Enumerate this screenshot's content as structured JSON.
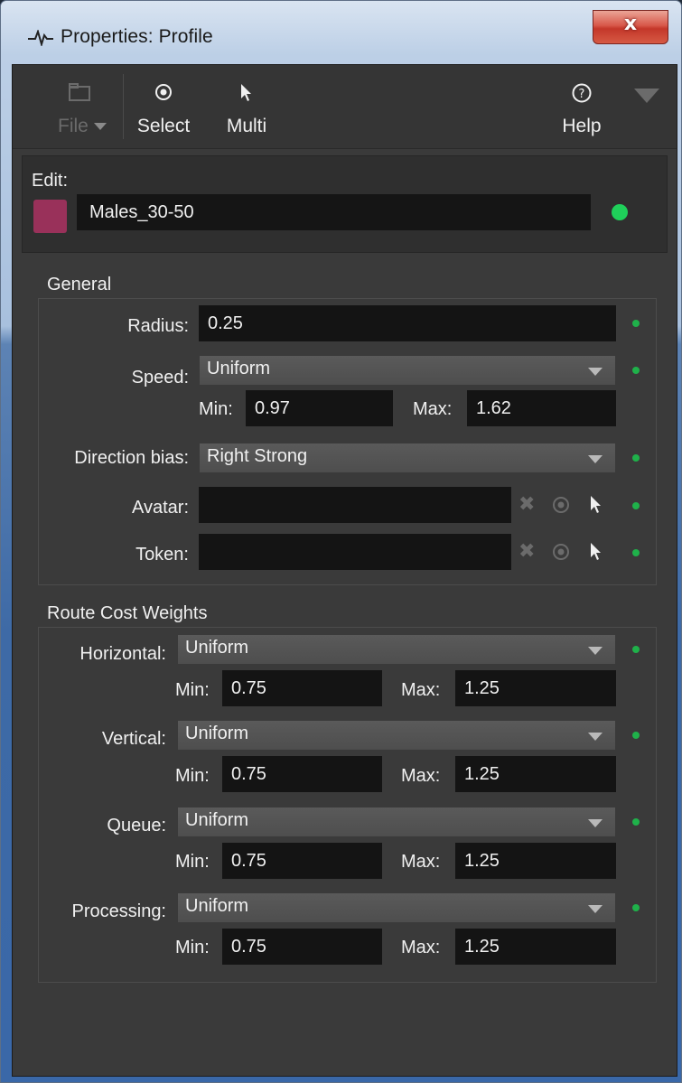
{
  "window": {
    "title": "Properties: Profile",
    "close_glyph": "x"
  },
  "toolbar": {
    "file_label": "File",
    "select_label": "Select",
    "multi_label": "Multi",
    "help_label": "Help"
  },
  "edit": {
    "label": "Edit:",
    "value": "Males_30-50",
    "swatch_color": "#99315a",
    "status_color": "#1fd05a"
  },
  "general": {
    "title": "General",
    "radius": {
      "label": "Radius:",
      "value": "0.25"
    },
    "speed": {
      "label": "Speed:",
      "selected": "Uniform",
      "min_label": "Min:",
      "min": "0.97",
      "max_label": "Max:",
      "max": "1.62"
    },
    "direction_bias": {
      "label": "Direction bias:",
      "selected": "Right Strong"
    },
    "avatar": {
      "label": "Avatar:",
      "value": ""
    },
    "token": {
      "label": "Token:",
      "value": ""
    }
  },
  "route_cost_weights": {
    "title": "Route Cost Weights",
    "rows": [
      {
        "label": "Horizontal:",
        "selected": "Uniform",
        "min_label": "Min:",
        "min": "0.75",
        "max_label": "Max:",
        "max": "1.25"
      },
      {
        "label": "Vertical:",
        "selected": "Uniform",
        "min_label": "Min:",
        "min": "0.75",
        "max_label": "Max:",
        "max": "1.25"
      },
      {
        "label": "Queue:",
        "selected": "Uniform",
        "min_label": "Min:",
        "min": "0.75",
        "max_label": "Max:",
        "max": "1.25"
      },
      {
        "label": "Processing:",
        "selected": "Uniform",
        "min_label": "Min:",
        "min": "0.75",
        "max_label": "Max:",
        "max": "1.25"
      }
    ]
  }
}
